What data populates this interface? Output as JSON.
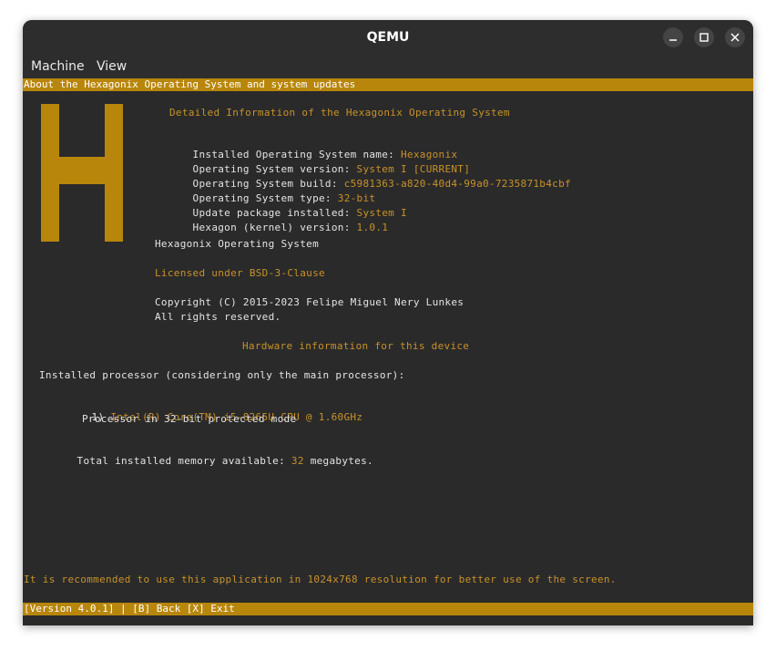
{
  "window": {
    "title": "QEMU"
  },
  "menu": {
    "machine": "Machine",
    "view": "View"
  },
  "header": {
    "text": "About the Hexagonix Operating System and system updates"
  },
  "logo": {
    "letter": "H",
    "color": "#b8860b"
  },
  "info": {
    "heading": "Detailed Information of the Hexagonix Operating System",
    "name_label": "Installed Operating System name: ",
    "name_value": "Hexagonix",
    "version_label": "Operating System version: ",
    "version_value": "System I [CURRENT]",
    "build_label": "Operating System build: ",
    "build_value": "c5981363-a820-40d4-99a0-7235871b4cbf",
    "type_label": "Operating System type: ",
    "type_value": "32-bit",
    "update_label": "Update package installed: ",
    "update_value": "System I",
    "kernel_label": "Hexagon (kernel) version: ",
    "kernel_value": "1.0.1",
    "os_name": "Hexagonix Operating System",
    "license": "Licensed under BSD-3-Clause",
    "copyright": "Copyright (C) 2015-2023 Felipe Miguel Nery Lunkes",
    "rights": "All rights reserved."
  },
  "hardware": {
    "heading": "Hardware information for this device",
    "processor_intro": "Installed processor (considering only the main processor):",
    "cpu_index": "1) ",
    "cpu_name": "Intel(R) Core(TM) i5-8265U CPU @ 1.60GHz",
    "cpu_mode": "Processor in 32-bit protected mode",
    "memory_label": "Total installed memory available: ",
    "memory_value": "32",
    "memory_unit": " megabytes."
  },
  "recommendation": "It is recommended to use this application in 1024x768 resolution for better use of the screen.",
  "footer": {
    "text": "[Version 4.0.1] | [B] Back [X] Exit"
  },
  "colors": {
    "accent": "#b8860b",
    "text_orange": "#c8922a",
    "background": "#2a2a2a"
  }
}
